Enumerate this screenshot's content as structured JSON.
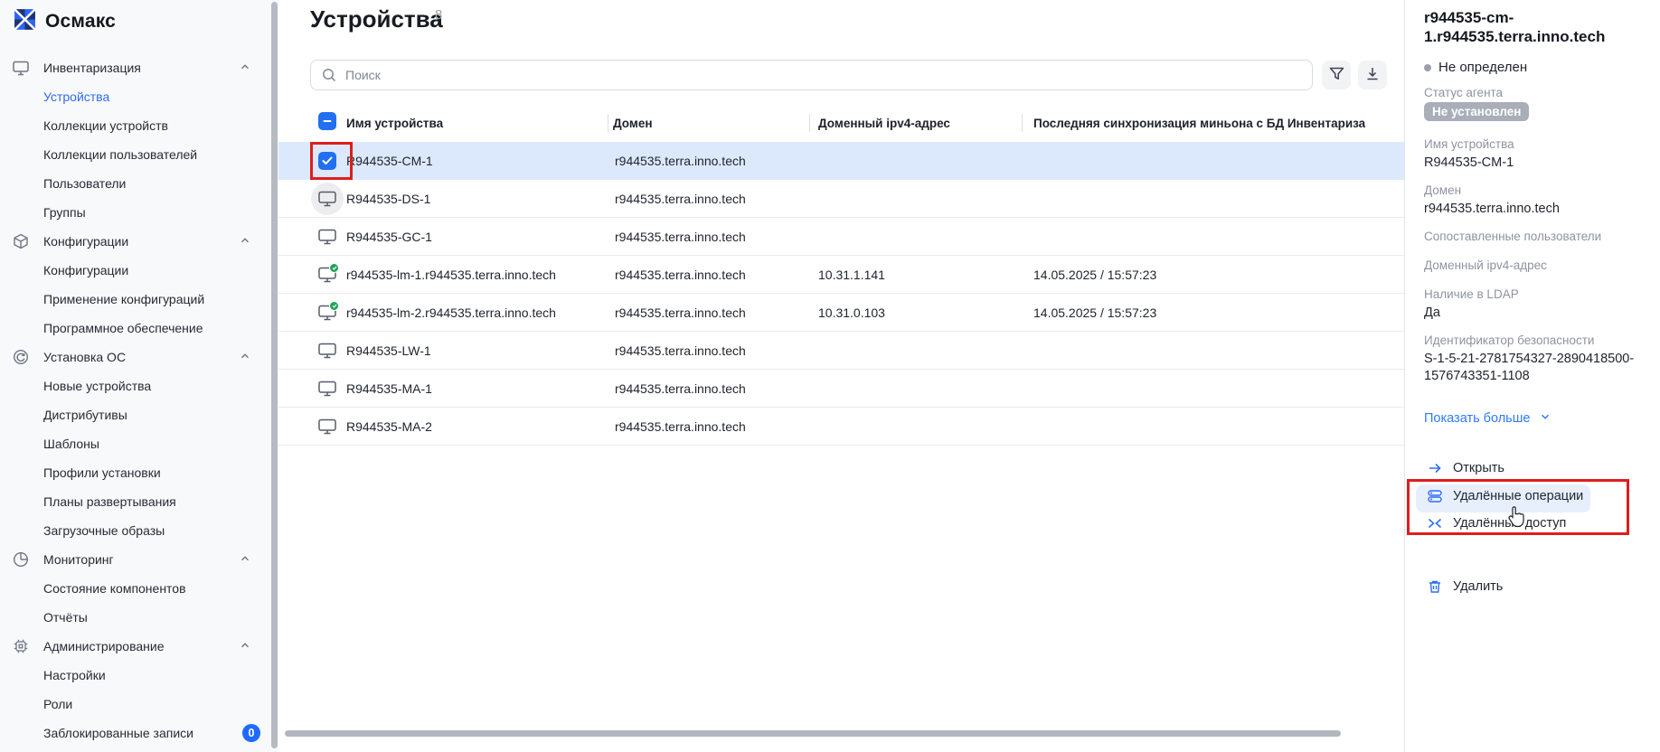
{
  "app": {
    "name": "Осмакс"
  },
  "sidebar": {
    "items": [
      {
        "label": "Инвентаризация"
      },
      {
        "label": "Устройства"
      },
      {
        "label": "Коллекции устройств"
      },
      {
        "label": "Коллекции пользователей"
      },
      {
        "label": "Пользователи"
      },
      {
        "label": "Группы"
      },
      {
        "label": "Конфигурации"
      },
      {
        "label": "Конфигурации"
      },
      {
        "label": "Применение конфигураций"
      },
      {
        "label": "Программное обеспечение"
      },
      {
        "label": "Установка ОС"
      },
      {
        "label": "Новые устройства"
      },
      {
        "label": "Дистрибутивы"
      },
      {
        "label": "Шаблоны"
      },
      {
        "label": "Профили установки"
      },
      {
        "label": "Планы развертывания"
      },
      {
        "label": "Загрузочные образы"
      },
      {
        "label": "Мониторинг"
      },
      {
        "label": "Состояние компонентов"
      },
      {
        "label": "Отчёты"
      },
      {
        "label": "Администрирование"
      },
      {
        "label": "Настройки"
      },
      {
        "label": "Роли"
      },
      {
        "label": "Заблокированные записи",
        "badge": "0"
      }
    ]
  },
  "header": {
    "title": "Устройства",
    "count": "8"
  },
  "search": {
    "placeholder": "Поиск"
  },
  "table": {
    "columns": [
      "Имя устройства",
      "Домен",
      "Доменный ipv4-адрес",
      "Последняя синхронизация миньона с БД Инвентариза"
    ],
    "rows": [
      {
        "name": "R944535-CM-1",
        "domain": "r944535.terra.inno.tech",
        "ip": "",
        "sync": ""
      },
      {
        "name": "R944535-DS-1",
        "domain": "r944535.terra.inno.tech",
        "ip": "",
        "sync": ""
      },
      {
        "name": "R944535-GC-1",
        "domain": "r944535.terra.inno.tech",
        "ip": "",
        "sync": ""
      },
      {
        "name": "r944535-lm-1.r944535.terra.inno.tech",
        "domain": "r944535.terra.inno.tech",
        "ip": "10.31.1.141",
        "sync": "14.05.2025 / 15:57:23"
      },
      {
        "name": "r944535-lm-2.r944535.terra.inno.tech",
        "domain": "r944535.terra.inno.tech",
        "ip": "10.31.0.103",
        "sync": "14.05.2025 / 15:57:23"
      },
      {
        "name": "R944535-LW-1",
        "domain": "r944535.terra.inno.tech",
        "ip": "",
        "sync": ""
      },
      {
        "name": "R944535-MA-1",
        "domain": "r944535.terra.inno.tech",
        "ip": "",
        "sync": ""
      },
      {
        "name": "R944535-MA-2",
        "domain": "r944535.terra.inno.tech",
        "ip": "",
        "sync": ""
      }
    ]
  },
  "panel": {
    "title": "r944535-cm-1.r944535.terra.inno.tech",
    "status": "Не определен",
    "agent_status_label": "Статус агента",
    "agent_status_badge": "Не установлен",
    "fields": [
      {
        "label": "Имя устройства",
        "value": "R944535-CM-1"
      },
      {
        "label": "Домен",
        "value": "r944535.terra.inno.tech"
      },
      {
        "label": "Сопоставленные пользователи",
        "value": ""
      },
      {
        "label": "Доменный ipv4-адрес",
        "value": ""
      },
      {
        "label": "Наличие в LDAP",
        "value": "Да"
      },
      {
        "label": "Идентификатор безопасности",
        "value": "S-1-5-21-2781754327-2890418500-1576743351-1108"
      }
    ],
    "show_more": "Показать больше",
    "actions": {
      "open": "Открыть",
      "remote_ops": "Удалённые операции",
      "remote_access": "Удалённый доступ",
      "delete": "Удалить"
    }
  },
  "colors": {
    "accent_blue": "#2e6bf0",
    "annotation_red": "#e01d1d",
    "selected_row": "#dce9fc",
    "badge_gray": "#a9aeb8",
    "online_green": "#21a35a"
  }
}
